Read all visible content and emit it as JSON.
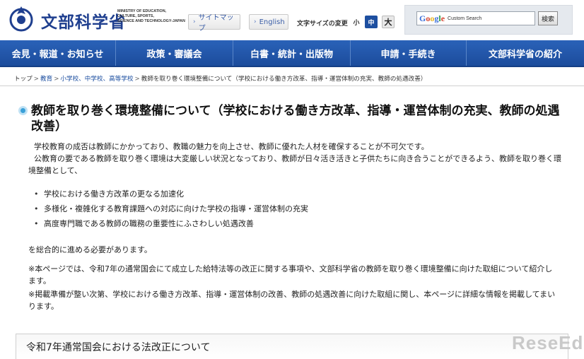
{
  "header": {
    "logo_title": "文部科学省",
    "logo_subtitle_lines": [
      "MINISTRY OF EDUCATION,",
      "CULTURE, SPORTS,",
      "SCIENCE AND TECHNOLOGY-JAPAN"
    ],
    "sitemap_label": "サイトマップ",
    "english_label": "English",
    "font_size_label": "文字サイズの変更",
    "font_small": "小",
    "font_medium": "中",
    "font_large": "大",
    "search_brand": "Google",
    "search_placeholder": "Custom Search",
    "search_button": "検索"
  },
  "nav": {
    "items": [
      {
        "label": "会見・報道・お知らせ"
      },
      {
        "label": "政策・審議会"
      },
      {
        "label": "白書・統計・出版物"
      },
      {
        "label": "申請・手続き"
      },
      {
        "label": "文部科学省の紹介"
      }
    ]
  },
  "breadcrumb": {
    "items": [
      "トップ",
      "教育",
      "小学校、中学校、高等学校"
    ],
    "current": "教師を取り巻く環境整備について（学校における働き方改革、指導・運営体制の充実、教師の処遇改善）"
  },
  "main": {
    "title": "教師を取り巻く環境整備について（学校における働き方改革、指導・運営体制の充実、教師の処遇改善）",
    "intro_1": "学校教育の成否は教師にかかっており、教職の魅力を向上させ、教師に優れた人材を確保することが不可欠です。",
    "intro_2": "公教育の要である教師を取り巻く環境は大変厳しい状況となっており、教師が日々活き活きと子供たちに向き合うことができるよう、教師を取り巻く環境整備として、",
    "bullets": [
      "学校における働き方改革の更なる加速化",
      "多様化・複雑化する教育課題への対応に向けた学校の指導・運営体制の充実",
      "高度専門職である教師の職務の重要性にふさわしい処遇改善"
    ],
    "conclusion": "を総合的に進める必要があります。",
    "note_1": "※本ページでは、令和7年の通常国会にて成立した給特法等の改正に関する事項や、文部科学省の教師を取り巻く環境整備に向けた取組について紹介します。",
    "note_2": "※掲載準備が整い次第、学校における働き方改革、指導・運営体制の改善、教師の処遇改善に向けた取組に関し、本ページに詳細な情報を掲載してまいります。",
    "section_title": "令和7年通常国会における法改正について"
  },
  "watermark": "ReseEd",
  "colors": {
    "nav_bg": "#1c4c9c",
    "link": "#1d4fa0",
    "accent_dot": "#3aa0d8"
  }
}
